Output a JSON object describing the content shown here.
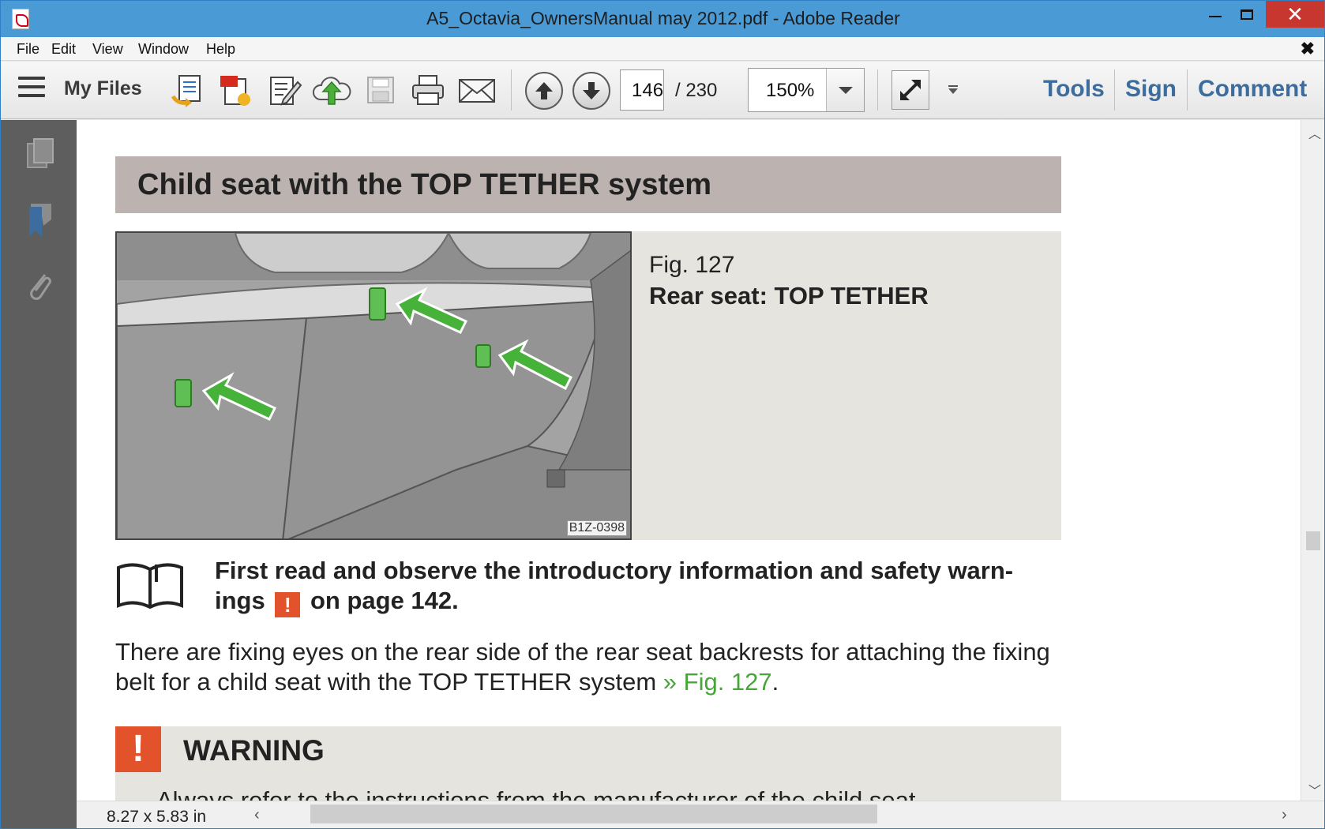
{
  "window": {
    "title": "A5_Octavia_OwnersManual may 2012.pdf - Adobe Reader",
    "close_glyph": "✕"
  },
  "menu": {
    "items": [
      "File",
      "Edit",
      "View",
      "Window",
      "Help"
    ],
    "close_glyph": "✖"
  },
  "toolbar": {
    "my_files": "My Files",
    "page_current": "146",
    "page_total": "/  230",
    "zoom": "150%",
    "tools": "Tools",
    "sign": "Sign",
    "comment": "Comment",
    "icons": [
      "create-pdf-icon",
      "convert-pdf-icon",
      "edit-pdf-icon",
      "upload-cloud-icon",
      "save-icon",
      "print-icon",
      "email-icon",
      "prev-page-icon",
      "next-page-icon",
      "fullscreen-icon"
    ]
  },
  "sidebar": {
    "icons": [
      "pages-icon",
      "bookmark-icon",
      "attachment-icon"
    ]
  },
  "document": {
    "section_title": "Child seat with the TOP TETHER system",
    "figure_number": "Fig. 127",
    "figure_caption": "Rear seat: TOP TETHER",
    "figure_code": "B1Z-0398",
    "read_first_before": "First read and observe the introductory information and safety warn-ings",
    "read_first_warn": "!",
    "read_first_after": "on page 142.",
    "body_before": "There are fixing eyes on the rear side of the rear seat backrests for attaching the fixing belt for a child seat with the TOP TETHER system",
    "body_link": "» Fig. 127",
    "body_after": ".",
    "warning_icon": "!",
    "warning_title": "WARNING",
    "warning_text": "Always refer to the instructions from the manufacturer of the child seat"
  },
  "status": {
    "page_size": "8.27 x 5.83 in"
  },
  "colors": {
    "accent_orange": "#e2522b",
    "link_green": "#47a53a",
    "header_gray": "#bcb3b0",
    "titlebar_blue": "#4a9ad6"
  }
}
